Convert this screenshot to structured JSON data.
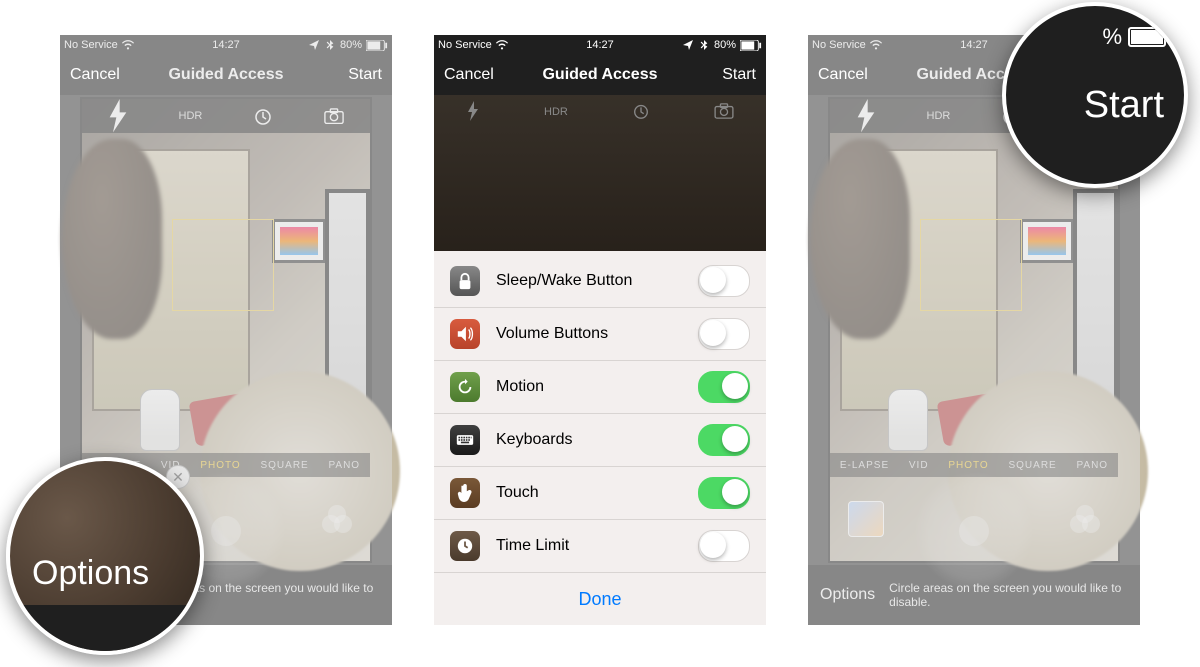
{
  "status": {
    "carrier": "No Service",
    "time": "14:27",
    "battery": "80%"
  },
  "nav": {
    "cancel": "Cancel",
    "title": "Guided Access",
    "start": "Start"
  },
  "camera": {
    "hdr": "HDR",
    "modes": {
      "timelapse": "E-LAPSE",
      "video": "VID",
      "photo": "PHOTO",
      "square": "SQUARE",
      "pano": "PANO"
    }
  },
  "bottom": {
    "options": "Options",
    "hint": "Circle areas on the screen you would like to disable."
  },
  "sheet": {
    "rows": [
      {
        "label": "Sleep/Wake Button",
        "on": false
      },
      {
        "label": "Volume Buttons",
        "on": false
      },
      {
        "label": "Motion",
        "on": true
      },
      {
        "label": "Keyboards",
        "on": true
      },
      {
        "label": "Touch",
        "on": true
      },
      {
        "label": "Time Limit",
        "on": false
      }
    ],
    "done": "Done"
  },
  "callouts": {
    "options": "Options",
    "start": "Start",
    "start_pct": "%"
  }
}
